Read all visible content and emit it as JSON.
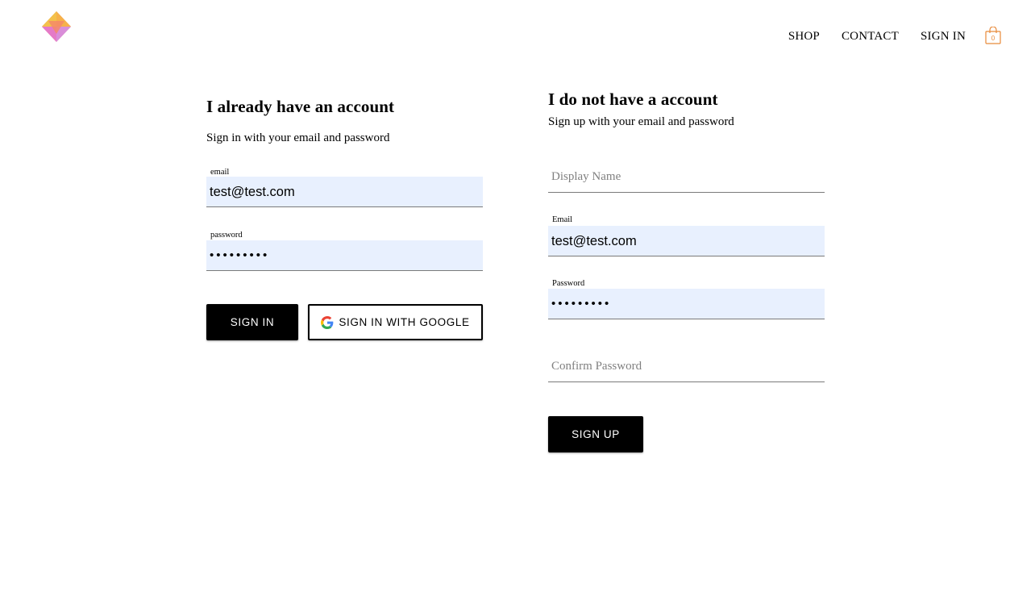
{
  "header": {
    "logo_icon": "crown-gem-logo-icon",
    "nav": [
      {
        "label": "SHOP"
      },
      {
        "label": "CONTACT"
      },
      {
        "label": "SIGN IN"
      }
    ],
    "cart": {
      "icon": "shopping-bag-icon",
      "count": "0",
      "color": "#e88a3a"
    }
  },
  "sign_in": {
    "title": "I already have an account",
    "subtitle": "Sign in with your email and password",
    "email_label": "email",
    "email_value": "test@test.com",
    "password_label": "password",
    "password_value": "•••••••••",
    "submit_label": "SIGN IN",
    "google_label": "SIGN IN WITH GOOGLE",
    "google_icon": "google-g-icon"
  },
  "sign_up": {
    "title": "I do not have a account",
    "subtitle": "Sign up with your email and password",
    "display_name_placeholder": "Display Name",
    "email_label": "Email",
    "email_value": "test@test.com",
    "password_label": "Password",
    "password_value": "•••••••••",
    "confirm_placeholder": "Confirm Password",
    "submit_label": "SIGN UP"
  },
  "colors": {
    "autofill_bg": "#e8f0fe",
    "button_bg": "#000000",
    "accent": "#e88a3a"
  }
}
